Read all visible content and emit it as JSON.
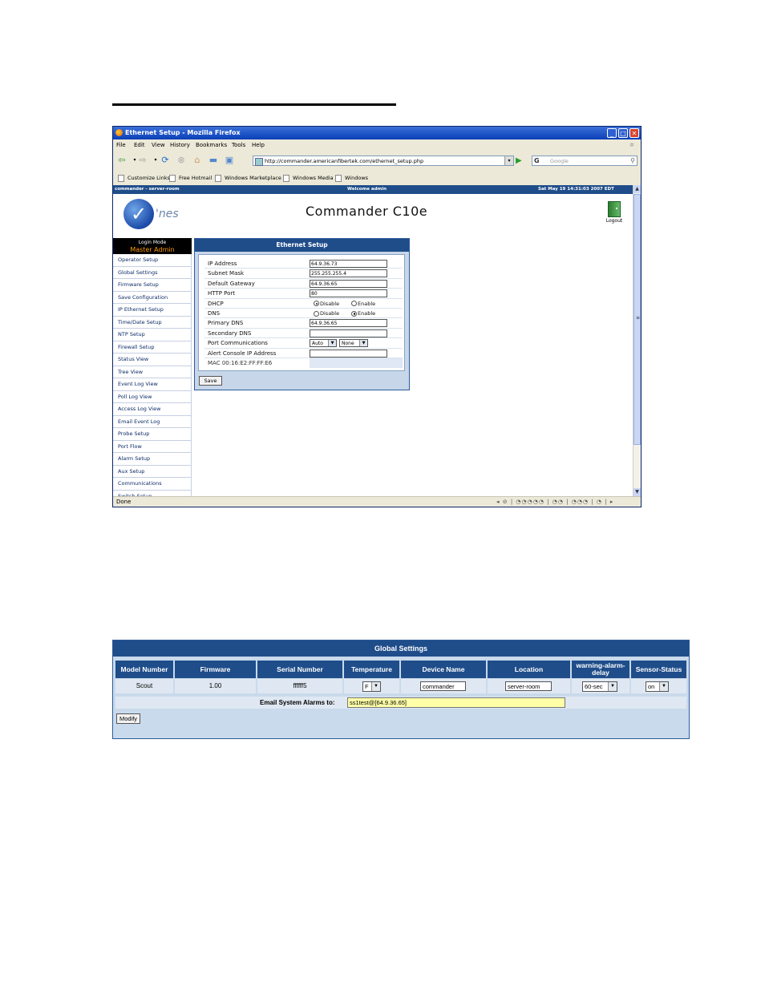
{
  "browser": {
    "window_title": "Ethernet Setup - Mozilla Firefox",
    "menu": [
      "File",
      "Edit",
      "View",
      "History",
      "Bookmarks",
      "Tools",
      "Help"
    ],
    "url": "http://commander.americanfibertek.com/ethernet_setup.php",
    "search_placeholder": "Google",
    "bookmarks": [
      "Customize Links",
      "Free Hotmail",
      "Windows Marketplace",
      "Windows Media",
      "Windows"
    ],
    "status": "Done"
  },
  "app": {
    "topbar_left": "commander - server-room",
    "topbar_center": "Welcome admin",
    "topbar_right": "Sat May 19 14:31:03 2007 EDT",
    "logo_text": "'nes",
    "title": "Commander C10e",
    "logout_label": "Logout",
    "login_mode_label": "Login Mode",
    "login_mode_value": "Master Admin",
    "sidebar": [
      "Operator Setup",
      "Global Settings",
      "Firmware Setup",
      "Save Configuration",
      "IP Ethernet Setup",
      "Time/Date Setup",
      "NTP Setup",
      "Firewall Setup",
      "Status View",
      "Tree View",
      "Event Log View",
      "Poll Log View",
      "Access Log View",
      "Email Event Log",
      "Probe Setup",
      "Port Flow",
      "Alarm Setup",
      "Aux Setup",
      "Communications",
      "Switch Setup"
    ]
  },
  "ethernet": {
    "header": "Ethernet Setup",
    "ip_label": "IP Address",
    "ip_value": "64.9.36.73",
    "subnet_label": "Subnet Mask",
    "subnet_value": "255.255.255.4",
    "gateway_label": "Default Gateway",
    "gateway_value": "64.9.36.65",
    "http_label": "HTTP Port",
    "http_value": "80",
    "dhcp_label": "DHCP",
    "dns_label": "DNS",
    "disable_label": "Disable",
    "enable_label": "Enable",
    "dhcp_selected": "Disable",
    "dns_selected": "Enable",
    "primary_dns_label": "Primary DNS",
    "primary_dns_value": "64.9.36.65",
    "secondary_dns_label": "Secondary DNS",
    "secondary_dns_value": "",
    "port_comm_label": "Port Communications",
    "port_comm_value1": "Auto",
    "port_comm_value2": "None",
    "alert_label": "Alert Console IP Address",
    "alert_value": "",
    "mac": "MAC 00:16:E2:FF:FF:E6",
    "save_label": "Save"
  },
  "global_settings": {
    "header": "Global Settings",
    "columns": [
      "Model Number",
      "Firmware",
      "Serial Number",
      "Temperature",
      "Device Name",
      "Location",
      "warning-alarm-delay",
      "Sensor-Status"
    ],
    "model": "Scout",
    "firmware": "1.00",
    "serial": "ffffff5",
    "temperature": "F",
    "device_name": "commander",
    "location": "server-room",
    "alarm_delay": "60-sec",
    "sensor_status": "on",
    "email_label": "Email System Alarms to:",
    "email_value": "ss1test@[64.9.36.65]",
    "modify_label": "Modify"
  }
}
